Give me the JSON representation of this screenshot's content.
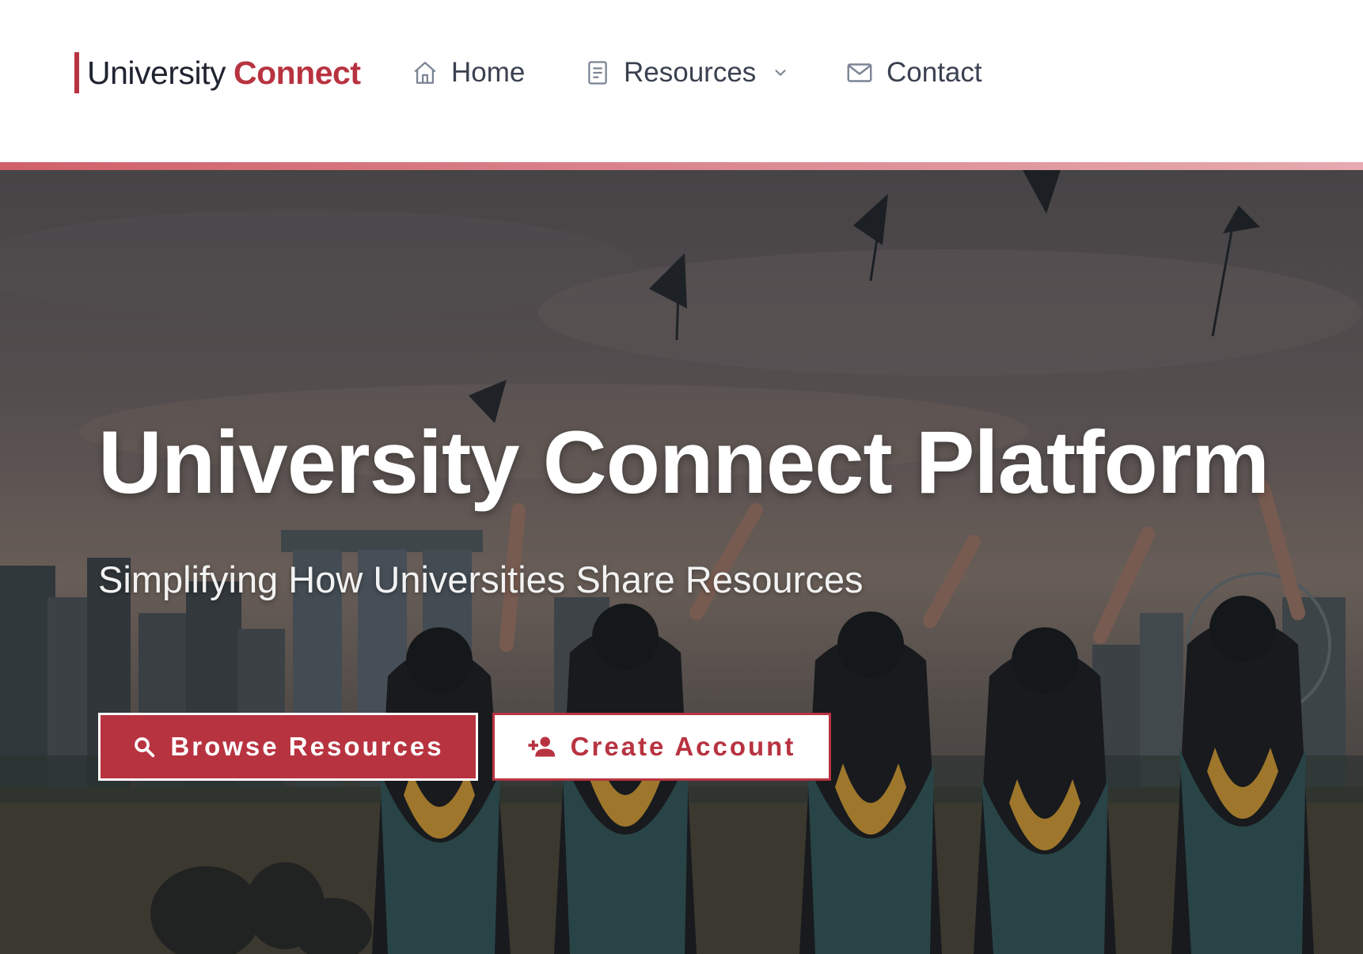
{
  "header": {
    "brand": {
      "primary": "University",
      "accent": "Connect"
    },
    "nav": [
      {
        "label": "Home",
        "icon": "home-icon"
      },
      {
        "label": "Resources",
        "icon": "document-icon",
        "dropdown": true
      },
      {
        "label": "Contact",
        "icon": "mail-icon"
      }
    ]
  },
  "hero": {
    "title": "University Connect Platform",
    "subtitle": "Simplifying How Universities Share Resources",
    "buttons": {
      "browse": {
        "label": "Browse Resources",
        "icon": "search-icon"
      },
      "create": {
        "label": "Create Account",
        "icon": "add-user-icon"
      }
    }
  },
  "colors": {
    "brand_red": "#b83340",
    "nav_text": "#3a4150",
    "white": "#ffffff"
  }
}
